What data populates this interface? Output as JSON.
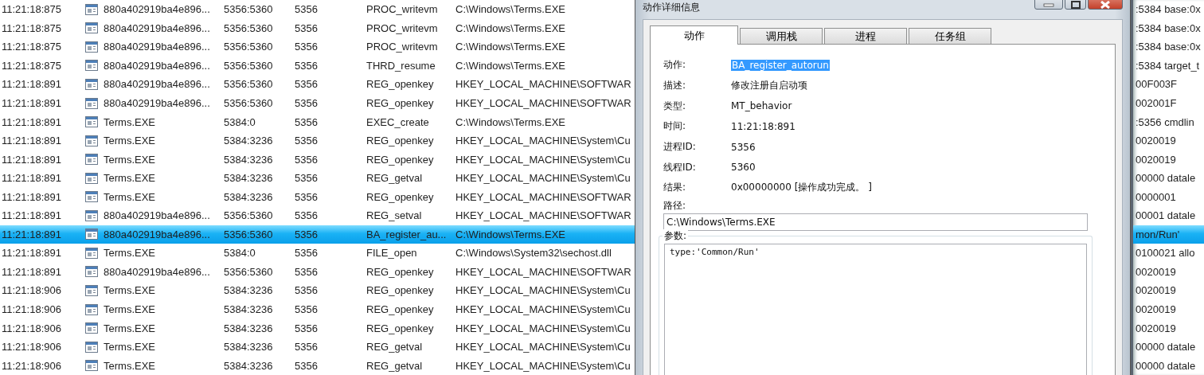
{
  "table": {
    "rows": [
      {
        "time": "11:21:18:875",
        "process": "880a402919ba4e896...",
        "tid": "5356:5360",
        "pid": "5356",
        "action": "PROC_writevm",
        "path": "C:\\Windows\\Terms.EXE",
        "detail": ":5384 base:0x",
        "selected": false
      },
      {
        "time": "11:21:18:875",
        "process": "880a402919ba4e896...",
        "tid": "5356:5360",
        "pid": "5356",
        "action": "PROC_writevm",
        "path": "C:\\Windows\\Terms.EXE",
        "detail": ":5384 base:0x",
        "selected": false
      },
      {
        "time": "11:21:18:875",
        "process": "880a402919ba4e896...",
        "tid": "5356:5360",
        "pid": "5356",
        "action": "PROC_writevm",
        "path": "C:\\Windows\\Terms.EXE",
        "detail": ":5384 base:0x",
        "selected": false
      },
      {
        "time": "11:21:18:875",
        "process": "880a402919ba4e896...",
        "tid": "5356:5360",
        "pid": "5356",
        "action": "THRD_resume",
        "path": "C:\\Windows\\Terms.EXE",
        "detail": ":5384 target_t",
        "selected": false
      },
      {
        "time": "11:21:18:891",
        "process": "880a402919ba4e896...",
        "tid": "5356:5360",
        "pid": "5356",
        "action": "REG_openkey",
        "path": "HKEY_LOCAL_MACHINE\\SOFTWAR",
        "detail": "00F003F",
        "selected": false
      },
      {
        "time": "11:21:18:891",
        "process": "880a402919ba4e896...",
        "tid": "5356:5360",
        "pid": "5356",
        "action": "REG_openkey",
        "path": "HKEY_LOCAL_MACHINE\\SOFTWAR",
        "detail": "002001F",
        "selected": false
      },
      {
        "time": "11:21:18:891",
        "process": "Terms.EXE",
        "tid": "5384:0",
        "pid": "5356",
        "action": "EXEC_create",
        "path": "C:\\Windows\\Terms.EXE",
        "detail": ":5356 cmdlin",
        "selected": false
      },
      {
        "time": "11:21:18:891",
        "process": "Terms.EXE",
        "tid": "5384:3236",
        "pid": "5356",
        "action": "REG_openkey",
        "path": "HKEY_LOCAL_MACHINE\\System\\Cu",
        "detail": "0020019",
        "selected": false
      },
      {
        "time": "11:21:18:891",
        "process": "Terms.EXE",
        "tid": "5384:3236",
        "pid": "5356",
        "action": "REG_openkey",
        "path": "HKEY_LOCAL_MACHINE\\System\\Cu",
        "detail": "0020019",
        "selected": false
      },
      {
        "time": "11:21:18:891",
        "process": "Terms.EXE",
        "tid": "5384:3236",
        "pid": "5356",
        "action": "REG_getval",
        "path": "HKEY_LOCAL_MACHINE\\System\\Cu",
        "detail": "00000 datale",
        "selected": false
      },
      {
        "time": "11:21:18:891",
        "process": "Terms.EXE",
        "tid": "5384:3236",
        "pid": "5356",
        "action": "REG_openkey",
        "path": "HKEY_LOCAL_MACHINE\\SOFTWAR",
        "detail": "0000001",
        "selected": false
      },
      {
        "time": "11:21:18:891",
        "process": "880a402919ba4e896...",
        "tid": "5356:5360",
        "pid": "5356",
        "action": "REG_setval",
        "path": "HKEY_LOCAL_MACHINE\\SOFTWAR",
        "detail": "00001 datale",
        "selected": false
      },
      {
        "time": "11:21:18:891",
        "process": "880a402919ba4e896...",
        "tid": "5356:5360",
        "pid": "5356",
        "action": "BA_register_au...",
        "path": "C:\\Windows\\Terms.EXE",
        "detail": "mon/Run'",
        "selected": true
      },
      {
        "time": "11:21:18:891",
        "process": "Terms.EXE",
        "tid": "5384:0",
        "pid": "5356",
        "action": "FILE_open",
        "path": "C:\\Windows\\System32\\sechost.dll",
        "detail": "0100021 allo",
        "selected": false
      },
      {
        "time": "11:21:18:891",
        "process": "880a402919ba4e896...",
        "tid": "5356:5360",
        "pid": "5356",
        "action": "REG_openkey",
        "path": "HKEY_LOCAL_MACHINE\\SOFTWAR",
        "detail": "0020019",
        "selected": false
      },
      {
        "time": "11:21:18:906",
        "process": "Terms.EXE",
        "tid": "5384:3236",
        "pid": "5356",
        "action": "REG_openkey",
        "path": "HKEY_LOCAL_MACHINE\\System\\Cu",
        "detail": "0020019",
        "selected": false
      },
      {
        "time": "11:21:18:906",
        "process": "Terms.EXE",
        "tid": "5384:3236",
        "pid": "5356",
        "action": "REG_openkey",
        "path": "HKEY_LOCAL_MACHINE\\System\\Cu",
        "detail": "0020019",
        "selected": false
      },
      {
        "time": "11:21:18:906",
        "process": "Terms.EXE",
        "tid": "5384:3236",
        "pid": "5356",
        "action": "REG_openkey",
        "path": "HKEY_LOCAL_MACHINE\\System\\Cu",
        "detail": "0020019",
        "selected": false
      },
      {
        "time": "11:21:18:906",
        "process": "Terms.EXE",
        "tid": "5384:3236",
        "pid": "5356",
        "action": "REG_getval",
        "path": "HKEY_LOCAL_MACHINE\\System\\Cu",
        "detail": "00000 datale",
        "selected": false
      },
      {
        "time": "11:21:18:906",
        "process": "Terms.EXE",
        "tid": "5384:3236",
        "pid": "5356",
        "action": "REG_getval",
        "path": "HKEY_LOCAL_MACHINE\\System\\Cu",
        "detail": "00000 datale",
        "selected": false
      }
    ]
  },
  "dialog": {
    "title": "动作详细信息",
    "tabs": [
      {
        "label": "动作",
        "selected": true
      },
      {
        "label": "调用栈",
        "selected": false
      },
      {
        "label": "进程",
        "selected": false
      },
      {
        "label": "任务组",
        "selected": false
      }
    ],
    "fields": [
      {
        "label": "动作:",
        "value": "BA_register_autorun",
        "selected": true
      },
      {
        "label": "描述:",
        "value": "修改注册自启动项",
        "selected": false
      },
      {
        "label": "类型:",
        "value": "MT_behavior",
        "selected": false
      },
      {
        "label": "时间:",
        "value": "11:21:18:891",
        "selected": false
      },
      {
        "label": "进程ID:",
        "value": "5356",
        "selected": false
      },
      {
        "label": "线程ID:",
        "value": "5360",
        "selected": false
      },
      {
        "label": "结果:",
        "value": "0x00000000 [操作成功完成。 ]",
        "selected": false
      }
    ],
    "path": {
      "label": "路径:",
      "value": "C:\\Windows\\Terms.EXE"
    },
    "params": {
      "label": "参数:",
      "value": "type:'Common/Run'"
    }
  }
}
